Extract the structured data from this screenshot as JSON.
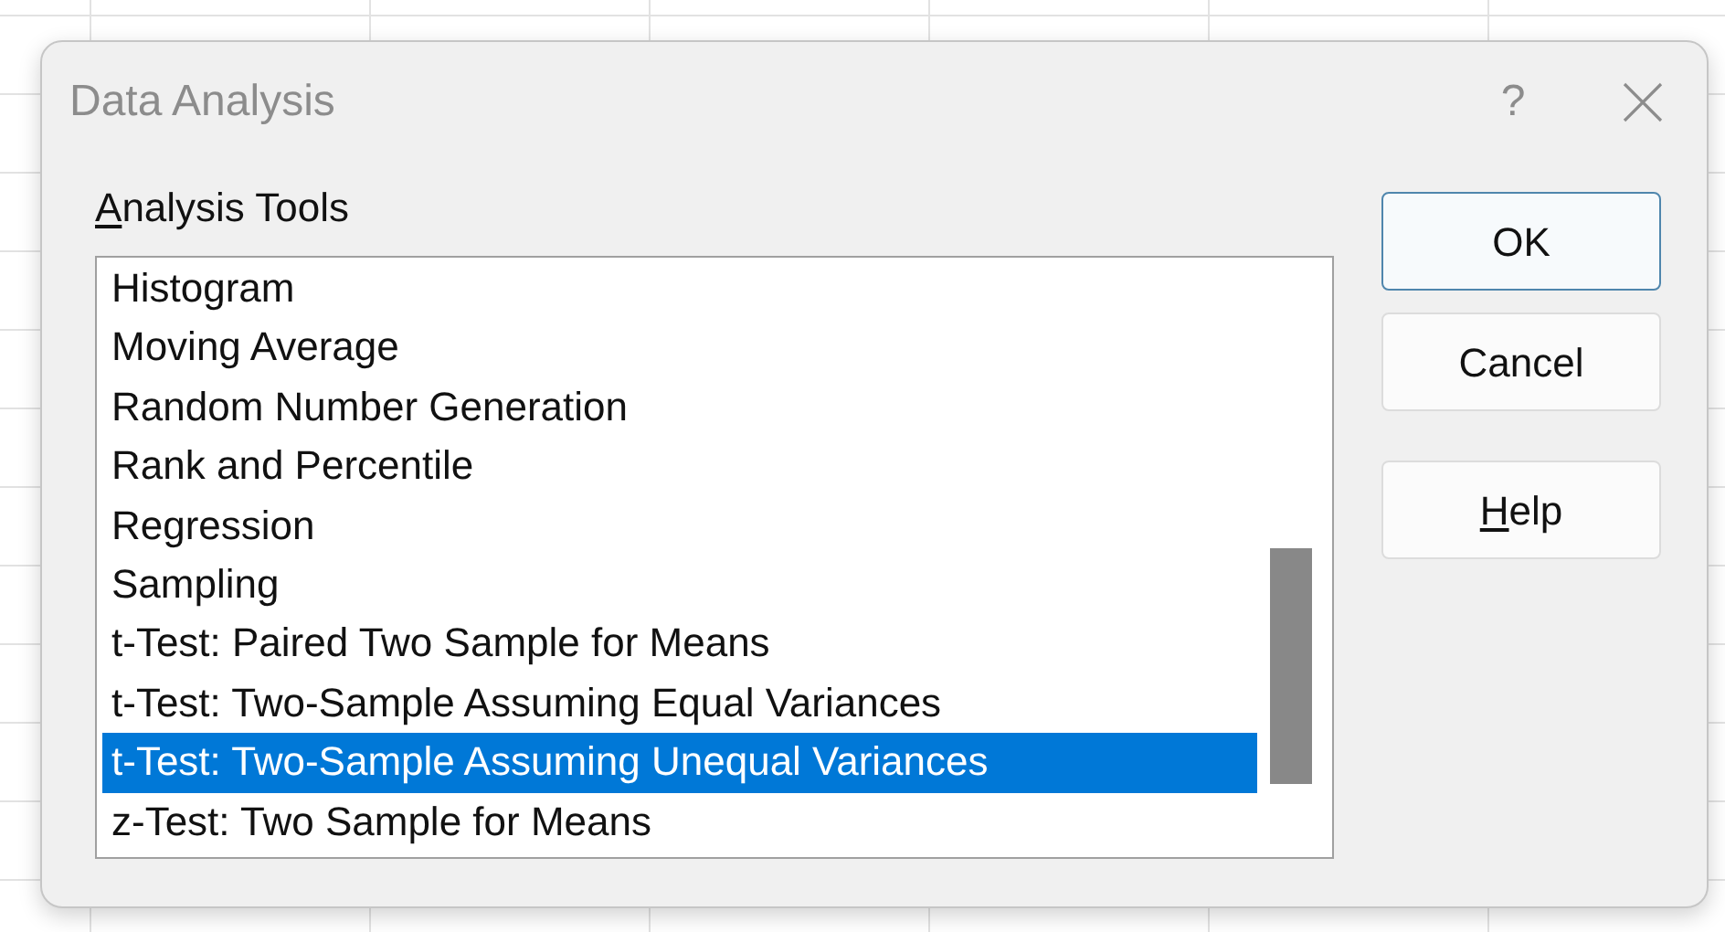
{
  "window": {
    "title": "Data Analysis",
    "help": "?"
  },
  "tools_label": {
    "text": "Analysis Tools",
    "underline_first": true
  },
  "list": {
    "items": [
      {
        "label": "Histogram",
        "selected": false
      },
      {
        "label": "Moving Average",
        "selected": false
      },
      {
        "label": "Random Number Generation",
        "selected": false
      },
      {
        "label": "Rank and Percentile",
        "selected": false
      },
      {
        "label": "Regression",
        "selected": false
      },
      {
        "label": "Sampling",
        "selected": false
      },
      {
        "label": "t-Test: Paired Two Sample for Means",
        "selected": false
      },
      {
        "label": "t-Test: Two-Sample Assuming Equal Variances",
        "selected": false
      },
      {
        "label": "t-Test: Two-Sample Assuming Unequal Variances",
        "selected": true
      },
      {
        "label": "z-Test: Two Sample for Means",
        "selected": false
      }
    ]
  },
  "buttons": [
    {
      "label": "OK",
      "default": true,
      "underline_first": false
    },
    {
      "label": "Cancel",
      "default": false,
      "underline_first": false
    },
    {
      "label": "Help",
      "default": false,
      "underline_first": true
    }
  ]
}
